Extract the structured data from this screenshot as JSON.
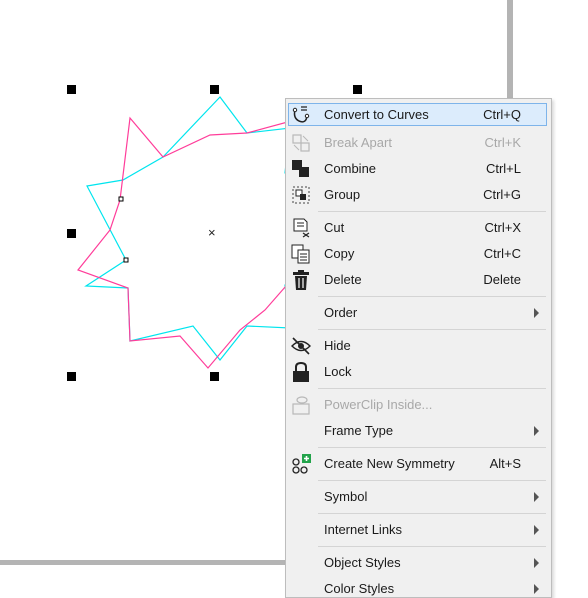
{
  "menu": {
    "items": [
      {
        "label": "Convert to Curves",
        "mnemonic": "v",
        "shortcut": "Ctrl+Q",
        "icon": "convert-to-curves-icon",
        "enabled": true,
        "highlighted": true
      },
      {
        "label": "Break Apart",
        "shortcut": "Ctrl+K",
        "icon": "break-apart-icon",
        "enabled": false
      },
      {
        "label": "Combine",
        "mnemonic": "C",
        "shortcut": "Ctrl+L",
        "icon": "combine-icon",
        "enabled": true
      },
      {
        "label": "Group",
        "mnemonic": "G",
        "shortcut": "Ctrl+G",
        "icon": "group-icon",
        "enabled": true
      },
      {
        "label": "Cut",
        "mnemonic": "t",
        "shortcut": "Ctrl+X",
        "icon": "cut-icon",
        "enabled": true
      },
      {
        "label": "Copy",
        "mnemonic": "C",
        "shortcut": "Ctrl+C",
        "icon": "copy-icon",
        "enabled": true
      },
      {
        "label": "Delete",
        "mnemonic": "l",
        "shortcut": "Delete",
        "icon": "delete-icon",
        "enabled": true
      },
      {
        "label": "Order",
        "mnemonic": "O",
        "submenu": true,
        "enabled": true
      },
      {
        "label": "Hide",
        "mnemonic": "H",
        "icon": "hide-icon",
        "enabled": true
      },
      {
        "label": "Lock",
        "mnemonic": "L",
        "icon": "lock-icon",
        "enabled": true
      },
      {
        "label": "PowerClip Inside...",
        "icon": "powerclip-icon",
        "enabled": false
      },
      {
        "label": "Frame Type",
        "mnemonic": "F",
        "submenu": true,
        "enabled": true
      },
      {
        "label": "Create New Symmetry",
        "mnemonic": "r",
        "shortcut": "Alt+S",
        "icon": "create-symmetry-icon",
        "enabled": true
      },
      {
        "label": "Symbol",
        "mnemonic": "y",
        "submenu": true,
        "enabled": true
      },
      {
        "label": "Internet Links",
        "mnemonic": "I",
        "submenu": true,
        "enabled": true
      },
      {
        "label": "Object Styles",
        "mnemonic": "S",
        "submenu": true,
        "enabled": true
      },
      {
        "label": "Color Styles",
        "submenu": true,
        "enabled": true
      }
    ]
  },
  "colors": {
    "highlight_bg": "#dcecfc",
    "highlight_border": "#7eb4ea",
    "shape_cyan": "#00e5ee",
    "shape_pink": "#ff3d9a",
    "disabled_text": "#a8a8a8"
  }
}
